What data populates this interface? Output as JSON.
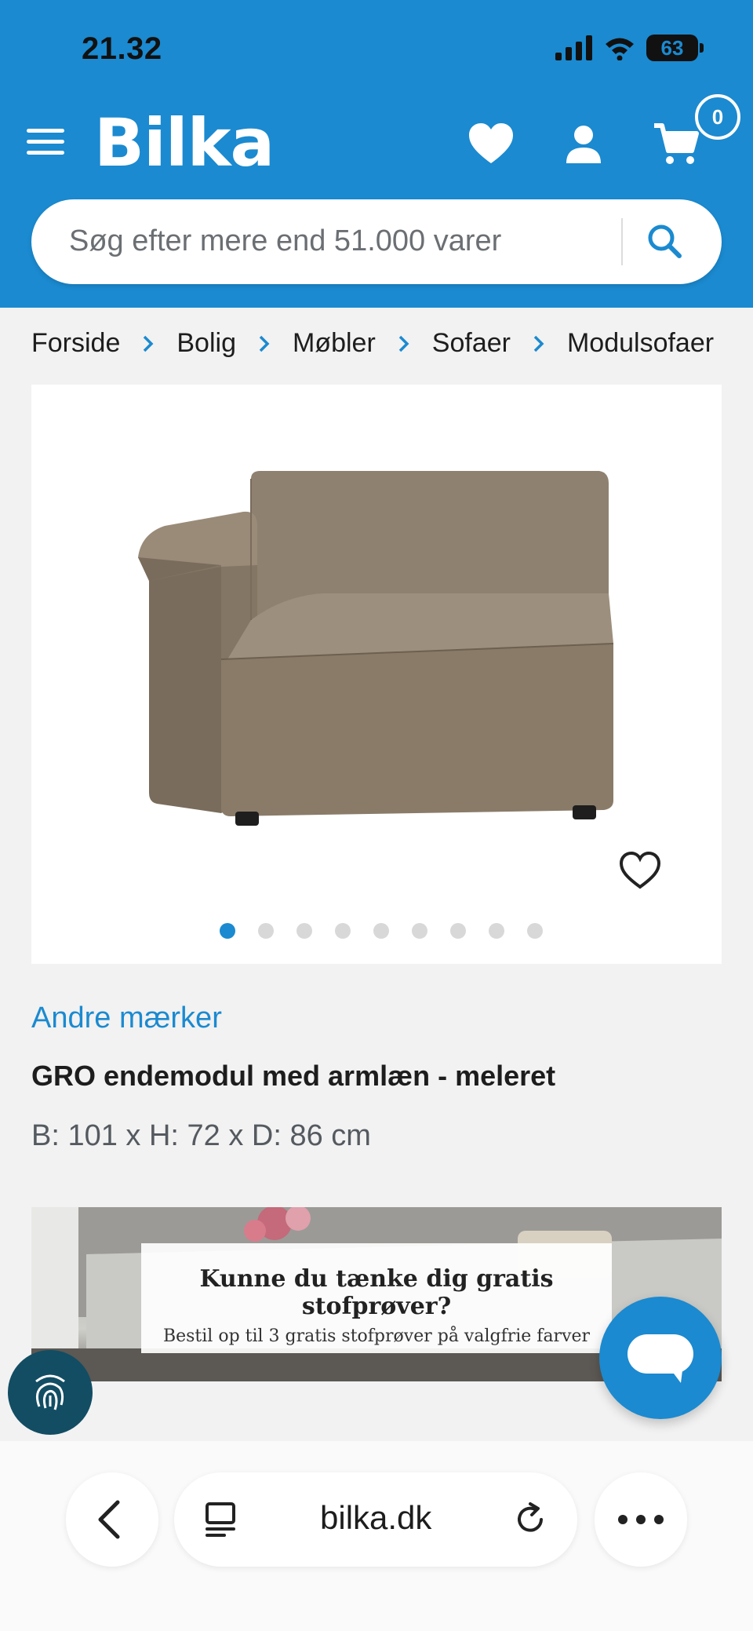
{
  "status_bar": {
    "time": "21.32",
    "battery": "63"
  },
  "header": {
    "logo": "Bilka",
    "cart_count": "0",
    "search_placeholder": "Søg efter mere end 51.000 varer",
    "brand_color": "#1b8ad0"
  },
  "breadcrumb": [
    "Forside",
    "Bolig",
    "Møbler",
    "Sofaer",
    "Modulsofaer"
  ],
  "product": {
    "brand": "Andre mærker",
    "title": "GRO endemodul med armlæn - meleret",
    "dimensions": "B: 101 x H: 72 x D: 86 cm",
    "image_count": 9,
    "active_image": 1
  },
  "banner": {
    "heading": "Kunne du tænke dig gratis stofprøver?",
    "subheading": "Bestil op til 3 gratis stofprøver på valgfrie farver"
  },
  "browser": {
    "url": "bilka.dk"
  },
  "icons": [
    "menu-icon",
    "heart-icon",
    "user-icon",
    "cart-icon",
    "search-icon",
    "chevron-right-icon",
    "favorite-icon",
    "chat-icon",
    "fingerprint-icon",
    "back-icon",
    "tabs-icon",
    "reload-icon",
    "more-icon"
  ]
}
